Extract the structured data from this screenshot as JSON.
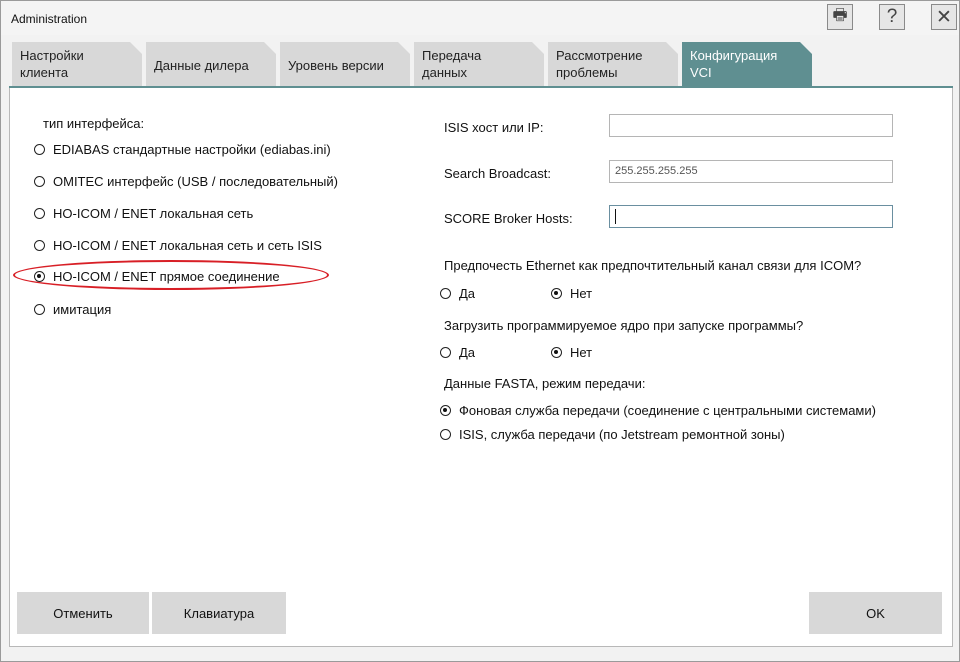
{
  "window": {
    "title": "Administration",
    "title_buttons": [
      {
        "name": "print-icon",
        "glyph": "🖶"
      },
      {
        "name": "help-icon",
        "glyph": "?"
      },
      {
        "name": "close-icon",
        "glyph": "✕"
      }
    ]
  },
  "tabs": [
    {
      "label": "Настройки клиента",
      "line1": "Настройки",
      "line2": "клиента",
      "active": false
    },
    {
      "label": "Данные дилера",
      "line1": "Данные дилера",
      "line2": "",
      "active": false
    },
    {
      "label": "Уровень версии",
      "line1": "Уровень версии",
      "line2": "",
      "active": false
    },
    {
      "label": "Передача данных",
      "line1": "Передача",
      "line2": "данных",
      "active": false
    },
    {
      "label": "Рассмотрение проблемы",
      "line1": "Рассмотрение",
      "line2": "проблемы",
      "active": false
    },
    {
      "label": "Конфигурация VCI",
      "line1": "Конфигурация",
      "line2": "VCI",
      "active": true
    }
  ],
  "interface": {
    "heading": "тип интерфейса:",
    "options": [
      {
        "label": "EDIABAS стандартные настройки (ediabas.ini)",
        "checked": false
      },
      {
        "label": "OMITEC интерфейс (USB / последовательный)",
        "checked": false
      },
      {
        "label": "HO-ICOM / ENET локальная сеть",
        "checked": false
      },
      {
        "label": "HO-ICOM / ENET локальная сеть и сеть ISIS",
        "checked": false
      },
      {
        "label": "HO-ICOM / ENET прямое соединение",
        "checked": true
      },
      {
        "label": "имитация",
        "checked": false
      }
    ]
  },
  "network": {
    "isis_host_label": "ISIS хост или IP:",
    "isis_host_value": "",
    "broadcast_label": "Search Broadcast:",
    "broadcast_value": "255.255.255.255",
    "score_label": "SCORE Broker Hosts:",
    "score_value": ""
  },
  "ethernet": {
    "question": "Предпочесть Ethernet как предпочтительный канал связи для ICOM?",
    "yes": "Да",
    "no": "Нет",
    "selected": "no"
  },
  "kernel": {
    "question": "Загрузить программируемое ядро при запуске программы?",
    "yes": "Да",
    "no": "Нет",
    "selected": "no"
  },
  "fasta": {
    "question": "Данные FASTA, режим передачи:",
    "options": [
      {
        "label": "Фоновая служба передачи (соединение с центральными системами)",
        "checked": true
      },
      {
        "label": "ISIS, служба передачи (по Jetstream ремонтной зоны)",
        "checked": false
      }
    ]
  },
  "buttons": {
    "cancel": "Отменить",
    "keyboard": "Клавиатура",
    "ok": "OK"
  },
  "colors": {
    "active_tab": "#5f8f91",
    "highlight": "#d81f26"
  }
}
